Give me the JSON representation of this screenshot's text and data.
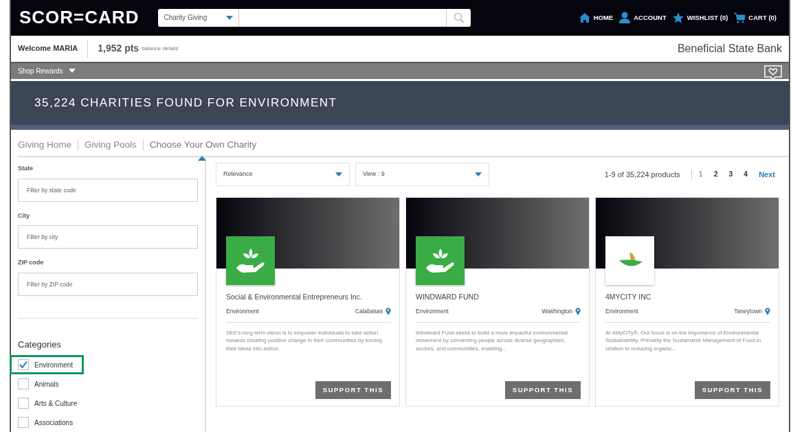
{
  "header": {
    "logo": "SCOR=CARD",
    "search": {
      "category": "Charity Giving"
    },
    "nav": [
      {
        "kind": "home",
        "label": "HOME"
      },
      {
        "kind": "account",
        "label": "ACCOUNT"
      },
      {
        "kind": "wishlist",
        "label": "WISHLIST (0)"
      },
      {
        "kind": "cart",
        "label": "CART (0)"
      }
    ]
  },
  "account_bar": {
    "welcome": "Welcome MARIA",
    "points": "1,952 pts",
    "points_link": "balance details",
    "bank": "Beneficial State Bank"
  },
  "menu_bar": {
    "label": "Shop Rewards"
  },
  "banner": {
    "title": "35,224 CHARITIES FOUND FOR ENVIRONMENT"
  },
  "tabs": [
    {
      "label": "Giving Home",
      "selected": false
    },
    {
      "label": "Giving Pools",
      "selected": false
    },
    {
      "label": "Choose Your Own Charity",
      "selected": true
    }
  ],
  "filters": [
    {
      "label": "State",
      "placeholder": "Filter by state code"
    },
    {
      "label": "City",
      "placeholder": "Filter by city"
    },
    {
      "label": "ZIP code",
      "placeholder": "Filter by ZIP code"
    }
  ],
  "categories": {
    "title": "Categories",
    "items": [
      {
        "label": "Environment",
        "checked": true,
        "highlighted": true
      },
      {
        "label": "Animals",
        "checked": false,
        "highlighted": false
      },
      {
        "label": "Arts & Culture",
        "checked": false,
        "highlighted": false
      },
      {
        "label": "Associations",
        "checked": false,
        "highlighted": false
      }
    ]
  },
  "toolbar": {
    "sort": "Relevance",
    "view": "View : 9",
    "count": "1-9 of 35,224 products",
    "pages": [
      {
        "label": "1",
        "selected": true
      },
      {
        "label": "2",
        "selected": false
      },
      {
        "label": "3",
        "selected": false
      },
      {
        "label": "4",
        "selected": false
      }
    ],
    "next": "Next"
  },
  "cards": [
    {
      "kind": "hand",
      "name": "Social & Environmental Entrepreneurs Inc.",
      "category": "Environment",
      "city": "Calabasas",
      "description": "SEE's long term vision is to empower individuals to take action towards creating positive change in their communities by turning their ideas into action.",
      "button": "SUPPORT THIS"
    },
    {
      "kind": "hand",
      "name": "WINDWARD FUND",
      "category": "Environment",
      "city": "Washington",
      "description": "Windward Fund seeks to build a more impactful environmental movement by connecting people across diverse geographies, sectors, and communities, enabling...",
      "button": "SUPPORT THIS"
    },
    {
      "kind": "leaf",
      "name": "4MYCITY INC",
      "category": "Environment",
      "city": "Taneytown",
      "description": "At 4MyCiTy®, Our focus is on the Importance of Environmental Sustainability. Primarily the Sustainable Management of Food in relation to reducing organic...",
      "button": "SUPPORT THIS"
    }
  ]
}
